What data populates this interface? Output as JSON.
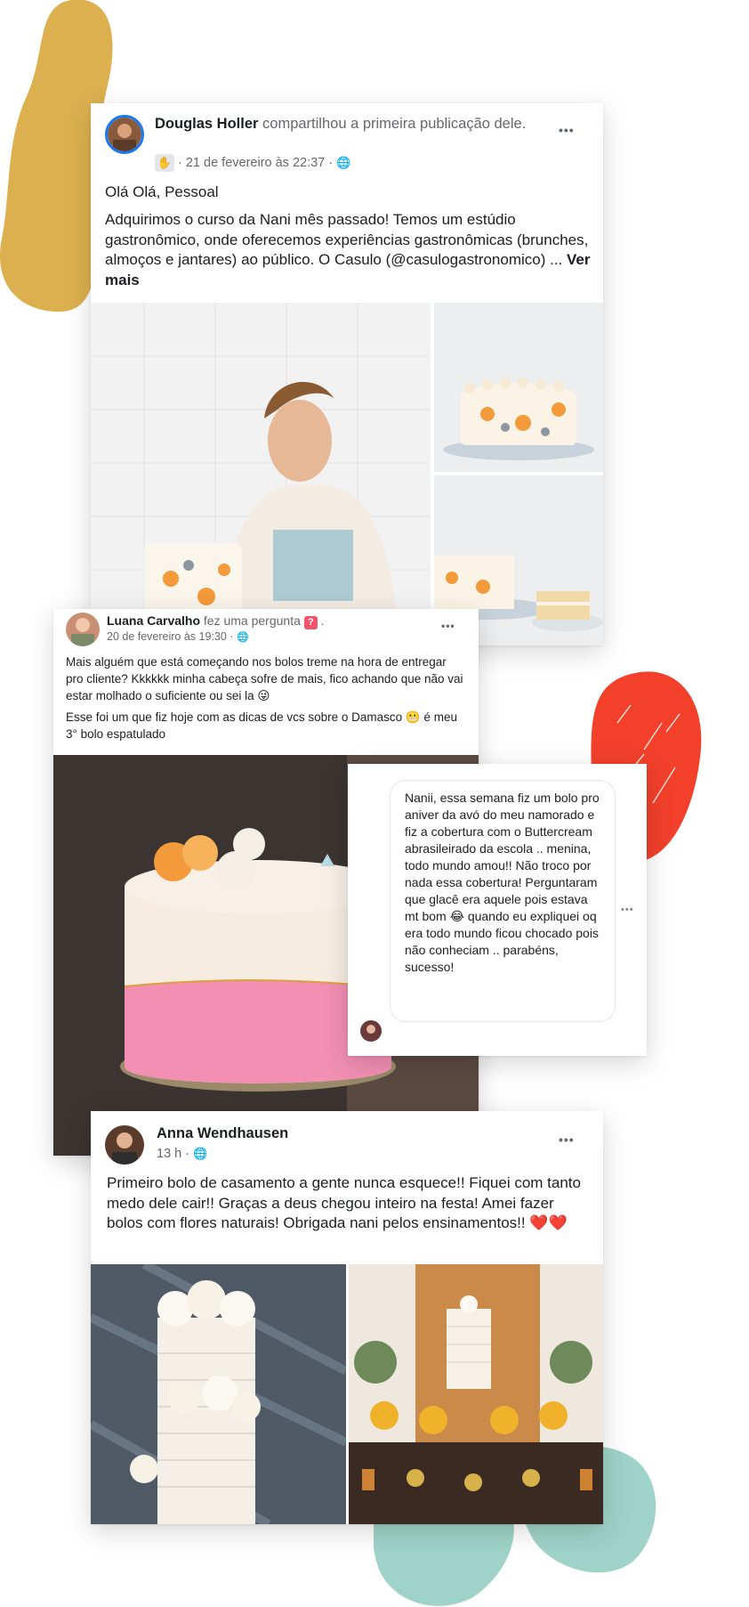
{
  "post1": {
    "author": "Douglas Holler",
    "action": "compartilhou a primeira publicação dele.",
    "timestamp": "· 21 de fevereiro às 22:37 ·",
    "greeting": "Olá Olá, Pessoal",
    "body": "Adquirimos o curso da Nani mês passado! Temos um estúdio gastronômico, onde oferecemos experiências gastronômicas (brunches, almoços e jantares) ao público. O Casulo (@casulogastronomico) ...",
    "see_more": "Ver mais",
    "menu_label": "•••"
  },
  "post2": {
    "author": "Luana Carvalho",
    "action": "fez uma pergunta",
    "action_suffix": ".",
    "timestamp": "20 de fevereiro às 19:30 ·",
    "body1": "Mais alguém que está começando nos bolos treme na hora de entregar pro cliente? Kkkkkk minha cabeça sofre de mais, fico achando que não vai estar molhado o suficiente ou sei la 😜",
    "body2": "Esse foi um que fiz hoje com as dicas de vcs sobre o Damasco 😬 é meu 3° bolo espatulado",
    "menu_label": "•••"
  },
  "comment": {
    "text": "Nanii, essa semana fiz um bolo pro aniver da avó do meu namorado e fiz a cobertura com o Buttercream abrasileirado da escola .. menina, todo mundo amou!! Não troco por nada essa cobertura! Perguntaram que glacê era aquele pois estava mt bom 😂 quando eu expliquei oq era todo mundo ficou chocado pois não conheciam .. parabéns, sucesso!",
    "menu_label": "•••"
  },
  "post3": {
    "author": "Anna Wendhausen",
    "timestamp": "13 h ·",
    "body": "Primeiro bolo de casamento a gente nunca esquece!! Fiquei com tanto medo dele cair!! Graças a deus chegou inteiro na festa! Amei fazer bolos com flores naturais! Obrigada nani pelos ensinamentos!! ❤️❤️",
    "menu_label": "•••"
  },
  "colors": {
    "blob_yellow": "#dcb04f",
    "blob_red": "#f2402b",
    "blob_teal": "#9fd3c7",
    "facebook_blue": "#1877f2",
    "cake_pink": "#f28fb3",
    "cake_orange": "#f39a3a"
  },
  "icons": {
    "globe": "globe-icon",
    "wave_badge": "wave-badge-icon",
    "question": "question-icon"
  }
}
